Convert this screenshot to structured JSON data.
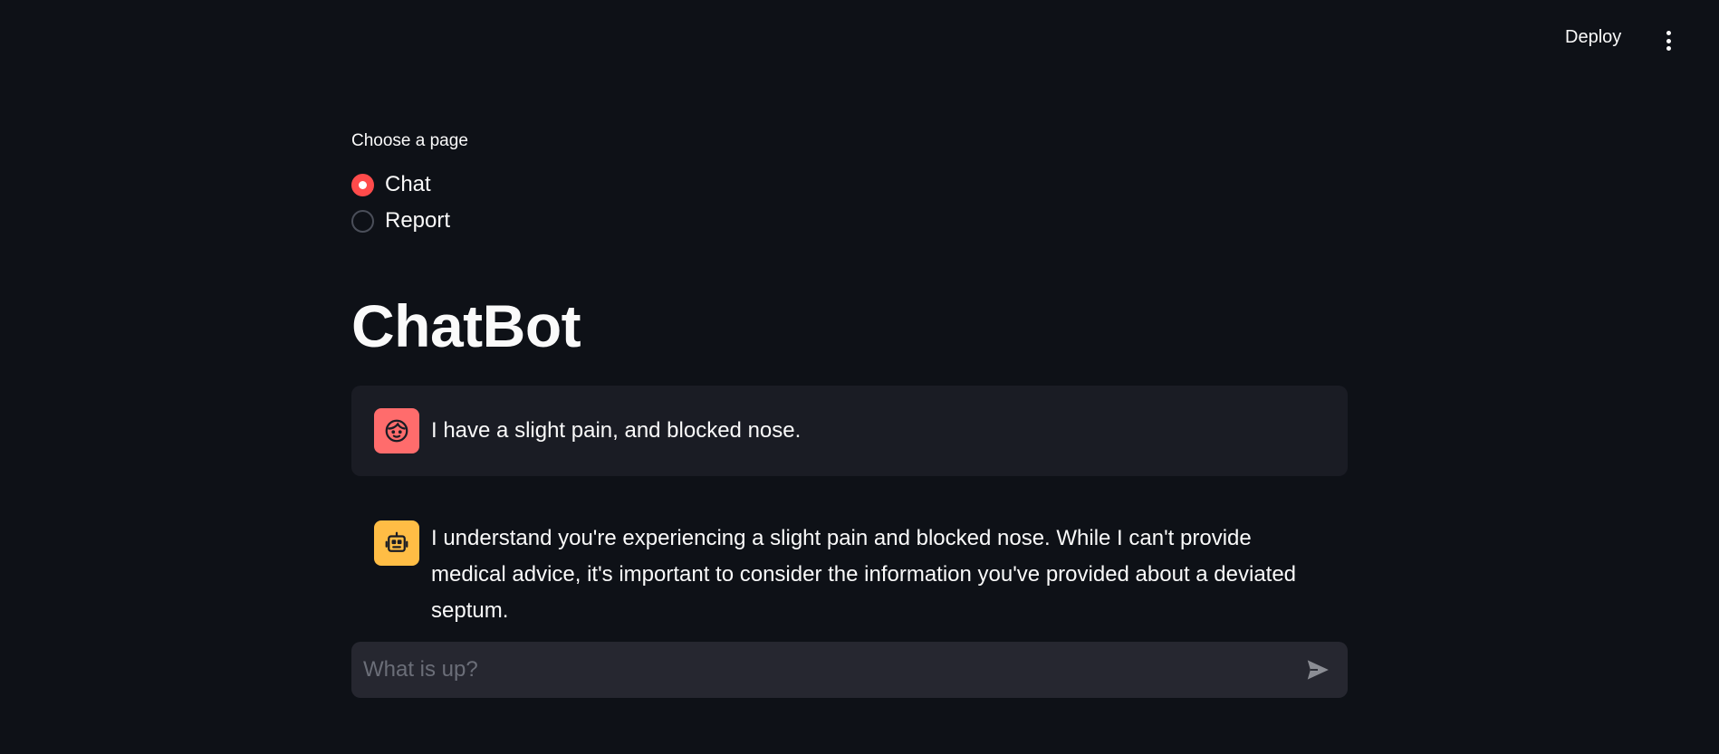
{
  "header": {
    "deploy_label": "Deploy",
    "menu_icon": "kebab-menu-icon"
  },
  "navigation": {
    "label": "Choose a page",
    "options": [
      {
        "label": "Chat",
        "selected": true
      },
      {
        "label": "Report",
        "selected": false
      }
    ]
  },
  "main": {
    "title": "ChatBot"
  },
  "messages": [
    {
      "role": "user",
      "avatar_icon": "user-face-icon",
      "text": "I have a slight pain, and blocked nose."
    },
    {
      "role": "assistant",
      "avatar_icon": "robot-icon",
      "text": "I understand you're experiencing a slight pain and blocked nose. While I can't provide medical advice, it's important to consider the information you've provided about a deviated septum."
    }
  ],
  "chat_input": {
    "placeholder": "What is up?",
    "value": "",
    "send_icon": "send-icon"
  },
  "colors": {
    "background": "#0e1117",
    "accent": "#ff4b4b",
    "user_avatar": "#ff6c6c",
    "bot_avatar": "#ffbd45",
    "user_message_bg": "#1a1c24",
    "input_bg": "#262730"
  }
}
